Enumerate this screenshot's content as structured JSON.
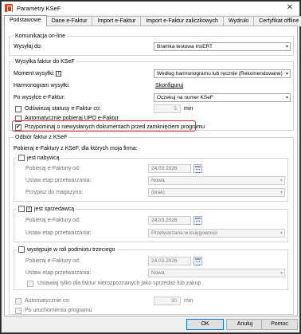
{
  "window": {
    "title": "Parametry KSeF",
    "close_glyph": "✕"
  },
  "tabs": [
    {
      "label": "Podstawowe"
    },
    {
      "label": "Dane e-Faktur"
    },
    {
      "label": "Import e-Faktur"
    },
    {
      "label": "Import e-Faktur zaliczkowych"
    },
    {
      "label": "Wydruki"
    },
    {
      "label": "Certyfikat offline"
    }
  ],
  "communication": {
    "title": "Komunikacja on-line",
    "send_to_label": "Wysyłaj do:",
    "send_to_value": "Bramka testowa InsERT"
  },
  "sending": {
    "title": "Wysyłka faktur do KSeF",
    "moment_label": "Moment wysyłki:",
    "moment_value": "Według harmonogramu lub ręcznie (Rekomendowane)",
    "schedule_label": "Harmonogram wysyłki:",
    "schedule_link": "Skonfiguruj",
    "after_label": "Po wysyłce e-Faktur:",
    "after_value": "Oczekuj na numer KSeF",
    "refresh_label": "Odświeżaj statusy e-Faktur co:",
    "refresh_value": "5",
    "refresh_unit": "min",
    "upo_label": "Automatycznie pobieraj UPO e-Faktur",
    "remind_label": "Przypominaj o niewysłanych dokumentach przed zamknięciem programu",
    "refresh_checked": false,
    "upo_checked": false,
    "remind_checked": true
  },
  "receiving": {
    "title": "Odbiór faktur z KSeF",
    "intro": "Pobieraj e-Faktury z KSeF, dla których moja firma:",
    "buyer": {
      "label": "jest nabywcą",
      "checked": false,
      "date_label": "Pobieraj e-Faktury od:",
      "date_value": "24.03.2026",
      "stage_label": "Ustaw etap przetwarzania:",
      "stage_value": "Nowa",
      "warehouse_label": "Przypisz do magazynu:",
      "warehouse_value": "(brak)"
    },
    "seller": {
      "label": "jest sprzedawcą",
      "checked": false,
      "date_label": "Pobieraj e-Faktury od:",
      "date_value": "24.03.2026",
      "stage_label": "Ustaw etap przetwarzania:",
      "stage_value": "Przetwarzana w księgowości"
    },
    "third_party": {
      "label": "występuje w roli podmiotu trzeciego",
      "checked": false,
      "date_label": "Pobieraj e-Faktury od:",
      "date_value": "24.03.2026",
      "stage_label": "Ustaw etap przetwarzania:",
      "stage_value": "Nowa",
      "only_unknown_label": "Ustawiaj tylko dla faktur nierozpoznanych jako sprzedaż lub zakup"
    },
    "auto_label": "Automatycznie co:",
    "auto_value": "30",
    "auto_unit": "min",
    "on_start_label": "Po uruchomieniu programu"
  },
  "buttons": {
    "ok": "OK",
    "cancel": "Anuluj",
    "help": "Pomoc"
  },
  "colors": {
    "highlight": "#e03030",
    "focus": "#0078d7"
  }
}
